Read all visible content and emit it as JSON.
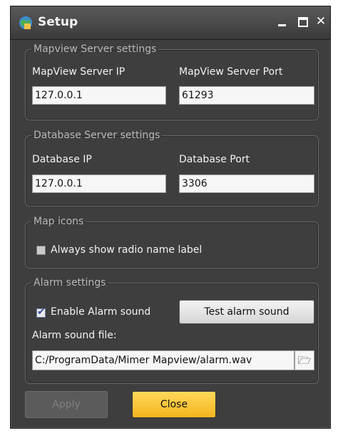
{
  "window": {
    "title": "Setup"
  },
  "mapview": {
    "legend": "Mapview Server settings",
    "ip_label": "MapView Server IP",
    "ip_value": "127.0.0.1",
    "port_label": "MapView Server Port",
    "port_value": "61293"
  },
  "database": {
    "legend": "Database Server settings",
    "ip_label": "Database IP",
    "ip_value": "127.0.0.1",
    "port_label": "Database Port",
    "port_value": "3306"
  },
  "map_icons": {
    "legend": "Map icons",
    "show_radio_label": "Always show radio name label",
    "show_radio_checked": false
  },
  "alarm": {
    "legend": "Alarm settings",
    "enable_label": "Enable Alarm sound",
    "enable_checked": true,
    "test_button": "Test alarm sound",
    "file_label": "Alarm sound file:",
    "file_value": "C:/ProgramData/Mimer Mapview/alarm.wav",
    "browse_icon": "folder-open-icon"
  },
  "footer": {
    "apply_label": "Apply",
    "apply_enabled": false,
    "close_label": "Close"
  },
  "colors": {
    "window_bg": "#3e3e3e",
    "accent": "#f4b51f"
  }
}
